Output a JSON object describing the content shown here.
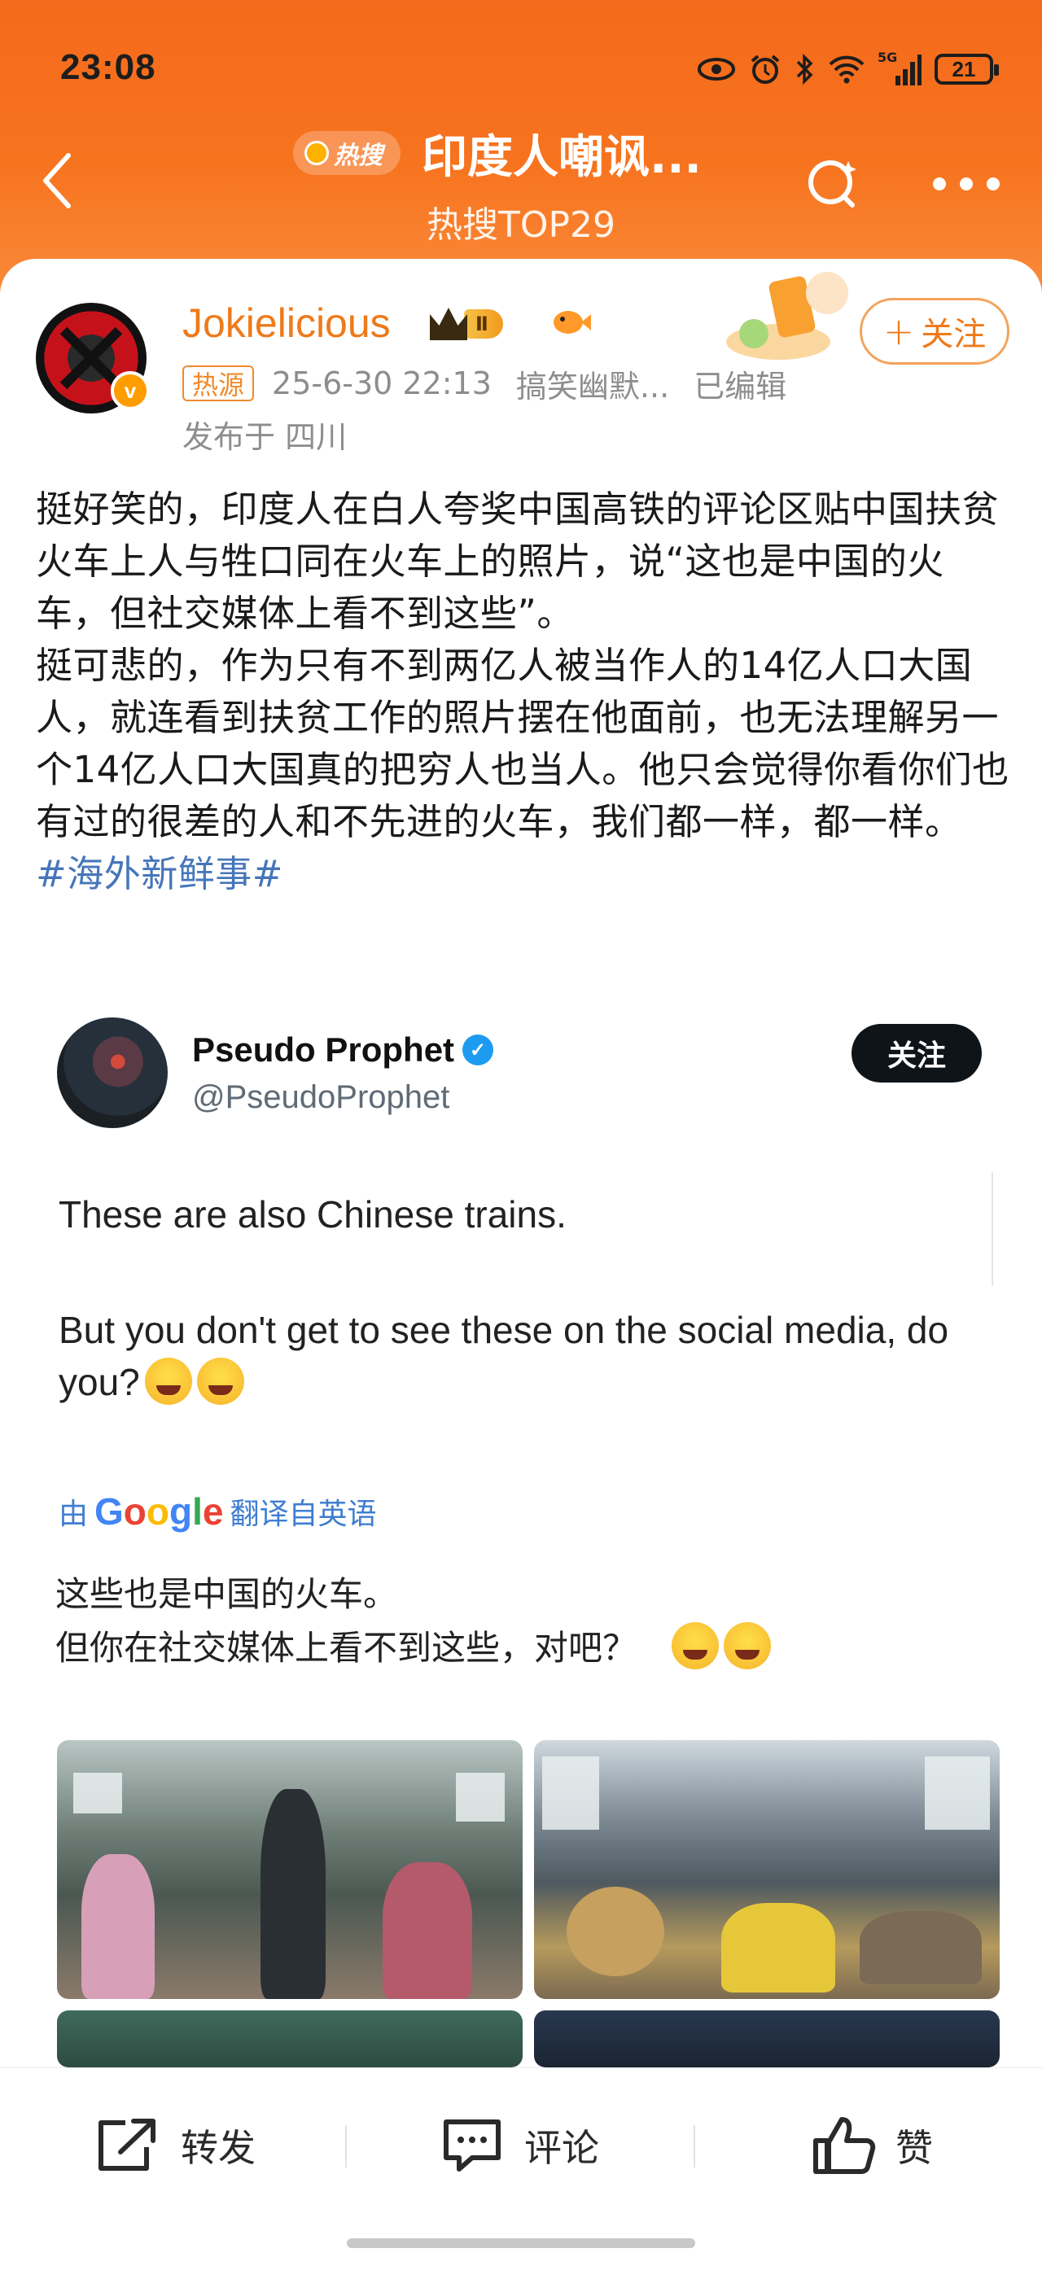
{
  "status_bar": {
    "time": "23:08",
    "network": "5G",
    "battery": "21"
  },
  "header": {
    "hot_badge": "热搜",
    "title": "印度人嘲讽...",
    "subtitle": "热搜TOP29",
    "accent_color": "#f46a1c"
  },
  "post": {
    "author": "Jokielicious",
    "vip_level": "Ⅱ",
    "source_tag": "热源",
    "timestamp": "25-6-30 22:13",
    "category": "搞笑幽默...",
    "edited": "已编辑",
    "location": "发布于 四川",
    "follow_label": "关注",
    "paragraph_1": "挺好笑的，印度人在白人夸奖中国高铁的评论区贴中国扶贫火车上人与牲口同在火车上的照片，说“这也是中国的火车，但社交媒体上看不到这些”。",
    "paragraph_2": "挺可悲的，作为只有不到两亿人被当作人的14亿人口大国人，就连看到扶贫工作的照片摆在他面前，也无法理解另一个14亿人口大国真的把穷人也当人。他只会觉得你看你们也有过的很差的人和不先进的火车，我们都一样，都一样。",
    "hashtag": "#海外新鲜事#"
  },
  "tweet": {
    "name": "Pseudo Prophet",
    "handle": "@PseudoProphet",
    "follow_label": "关注",
    "text_line_1": "These are also Chinese trains.",
    "text_line_2": "But you don't get to see these on the social media, do you?",
    "translate_prefix": "由",
    "translate_suffix": "翻译自英语",
    "zh_line_1": "这些也是中国的火车。",
    "zh_line_2": "但你在社交媒体上看不到这些，对吧？"
  },
  "actions": {
    "share": "转发",
    "comment": "评论",
    "like": "赞"
  },
  "icons": [
    "back-icon",
    "search-icon",
    "more-icon",
    "share-icon",
    "comment-icon",
    "like-icon",
    "verified-icon"
  ]
}
